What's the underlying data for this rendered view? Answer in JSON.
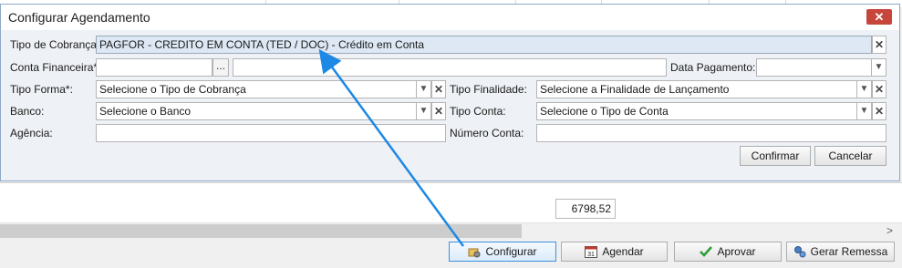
{
  "dialog": {
    "title": "Configurar Agendamento",
    "close_icon": "close-icon",
    "tipo_cobranca": {
      "label": "Tipo de Cobrança:",
      "value": "PAGFOR - CREDITO EM CONTA (TED / DOC) - Crédito em Conta"
    },
    "conta_financeira": {
      "label": "Conta Financeira*:",
      "code": "",
      "name": "",
      "lookup_label": "..."
    },
    "data_pagamento": {
      "label": "Data Pagamento:",
      "value": ""
    },
    "tipo_forma": {
      "label": "Tipo Forma*:",
      "placeholder": "Selecione o Tipo de Cobrança"
    },
    "tipo_finalidade": {
      "label": "Tipo Finalidade:",
      "placeholder": "Selecione a Finalidade de Lançamento"
    },
    "banco": {
      "label": "Banco:",
      "placeholder": "Selecione o Banco"
    },
    "tipo_conta": {
      "label": "Tipo Conta:",
      "placeholder": "Selecione o Tipo de Conta"
    },
    "agencia": {
      "label": "Agência:",
      "value": ""
    },
    "numero_conta": {
      "label": "Número Conta:",
      "value": ""
    },
    "confirm_label": "Confirmar",
    "cancel_label": "Cancelar"
  },
  "grid": {
    "total": "6798,52"
  },
  "toolbar": {
    "buttons": [
      {
        "label": "Configurar",
        "icon": "gear-folder-icon"
      },
      {
        "label": "Agendar",
        "icon": "calendar-icon",
        "icon_text": "31"
      },
      {
        "label": "Aprovar",
        "icon": "checkmark-icon"
      },
      {
        "label": "Gerar Remessa",
        "icon": "gears-icon"
      }
    ]
  },
  "colors": {
    "accent": "#1e88e5",
    "close": "#c6463c",
    "selected_field": "#dde8f4"
  }
}
